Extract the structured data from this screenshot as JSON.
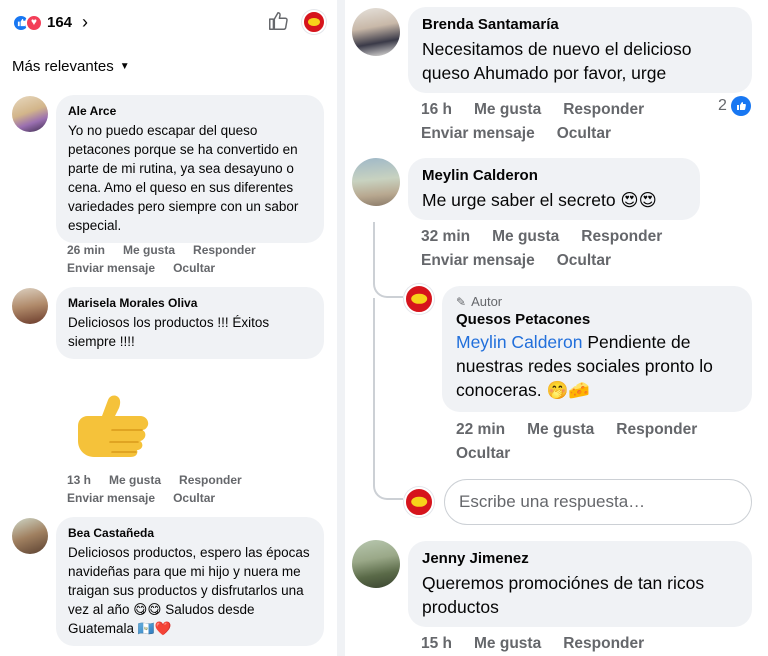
{
  "left": {
    "reaction_count": "164",
    "sort_label": "Más relevantes",
    "comments": [
      {
        "name": "Ale Arce",
        "text": "Yo no puedo escapar del queso petacones porque se ha convertido en parte de mi rutina, ya sea desayuno o cena. Amo el queso en sus diferentes variedades pero siempre con un sabor especial.",
        "time": "26 min",
        "like": "Me gusta",
        "reply": "Responder",
        "message": "Enviar mensaje",
        "hide": "Ocultar"
      },
      {
        "name": "Marisela Morales Oliva",
        "text": "Deliciosos los productos !!! Éxitos siempre !!!!",
        "time": "13 h",
        "like": "Me gusta",
        "reply": "Responder",
        "message": "Enviar mensaje",
        "hide": "Ocultar"
      },
      {
        "name": "Bea Castañeda",
        "text": "Deliciosos productos, espero las épocas navideñas para que mi hijo y nuera me traigan sus productos y disfrutarlos una vez al año 😋😋 Saludos desde Guatemala 🇬🇹❤️",
        "time": "",
        "like": "",
        "reply": "",
        "message": "",
        "hide": ""
      }
    ]
  },
  "right": {
    "comments": [
      {
        "name": "Brenda Santamaría",
        "text": "Necesitamos de nuevo el delicioso queso Ahumado por favor, urge",
        "time": "16 h",
        "like": "Me gusta",
        "reply": "Responder",
        "message": "Enviar mensaje",
        "hide": "Ocultar",
        "like_count": "2"
      },
      {
        "name": "Meylin Calderon",
        "text": "Me urge saber el secreto 😍😍",
        "time": "32 min",
        "like": "Me gusta",
        "reply": "Responder",
        "message": "Enviar mensaje",
        "hide": "Ocultar"
      },
      {
        "name": "Jenny Jimenez",
        "text": "Queremos promociónes de tan ricos productos",
        "time": "15 h",
        "like": "Me gusta",
        "reply": "Responder"
      }
    ],
    "reply": {
      "author_label": "Autor",
      "name": "Quesos Petacones",
      "mention": "Meylin Calderon",
      "text": " Pendiente de nuestras redes sociales pronto lo conoceras. 🤭🧀",
      "time": "22 min",
      "like": "Me gusta",
      "reply": "Responder",
      "hide": "Ocultar"
    },
    "reply_placeholder": "Escribe una respuesta…"
  },
  "colors": {
    "facebook_blue": "#1877f2",
    "love_red": "#f33e58",
    "bubble_gray": "#f0f2f5",
    "meta_gray": "#65676b",
    "brand_red": "#d6141c"
  }
}
